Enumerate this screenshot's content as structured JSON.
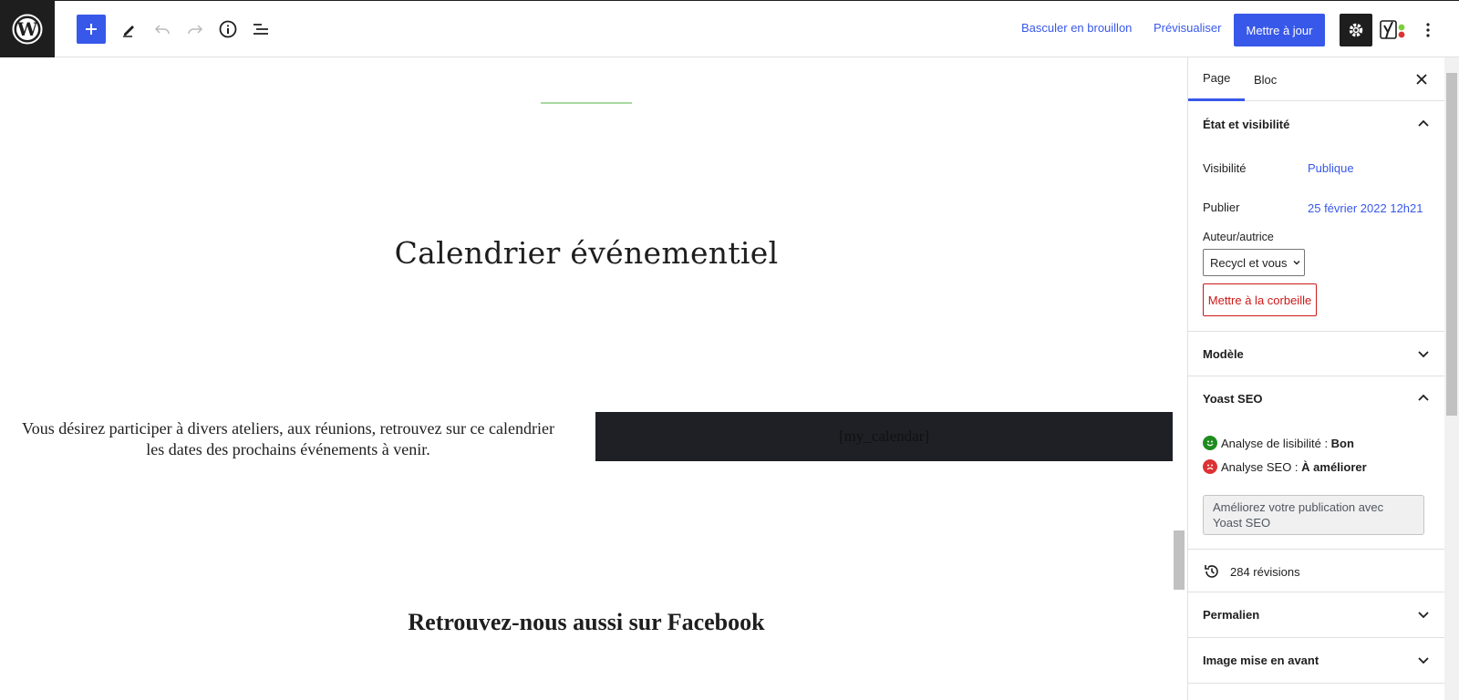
{
  "toolbar": {
    "switch_to_draft": "Basculer en brouillon",
    "preview": "Prévisualiser",
    "update": "Mettre à jour"
  },
  "canvas": {
    "heading": "Calendrier événementiel",
    "paragraph_line1": "Vous désirez participer à divers ateliers, aux réunions, retrouvez sur ce calendrier",
    "paragraph_line2": "les dates des prochains événements à venir.",
    "shortcode": "[my_calendar]",
    "heading2": "Retrouvez-nous aussi sur Facebook"
  },
  "sidebar": {
    "tabs": [
      {
        "label": "Page",
        "active": true
      },
      {
        "label": "Bloc",
        "active": false
      }
    ],
    "status_panel": {
      "title": "État et visibilité",
      "visibility_label": "Visibilité",
      "visibility_value": "Publique",
      "publish_label": "Publier",
      "publish_value": "25 février 2022 12h21",
      "author_label": "Auteur/autrice",
      "author_value": "Recycl et vous",
      "trash": "Mettre à la corbeille"
    },
    "template_panel": {
      "title": "Modèle"
    },
    "yoast_panel": {
      "title": "Yoast SEO",
      "readability_label": "Analyse de lisibilité : ",
      "readability_value": "Bon",
      "seo_label": "Analyse SEO : ",
      "seo_value": "À améliorer",
      "improve_button": "Améliorez votre publication avec Yoast SEO"
    },
    "revisions": "284 révisions",
    "permalink_panel": {
      "title": "Permalien"
    },
    "featured_image_panel": {
      "title": "Image mise en avant"
    }
  },
  "colors": {
    "accent": "#3858e9",
    "dark": "#1e1e1e",
    "trash": "#cc1818",
    "good": "#1e8c1e",
    "bad": "#dc3232"
  }
}
